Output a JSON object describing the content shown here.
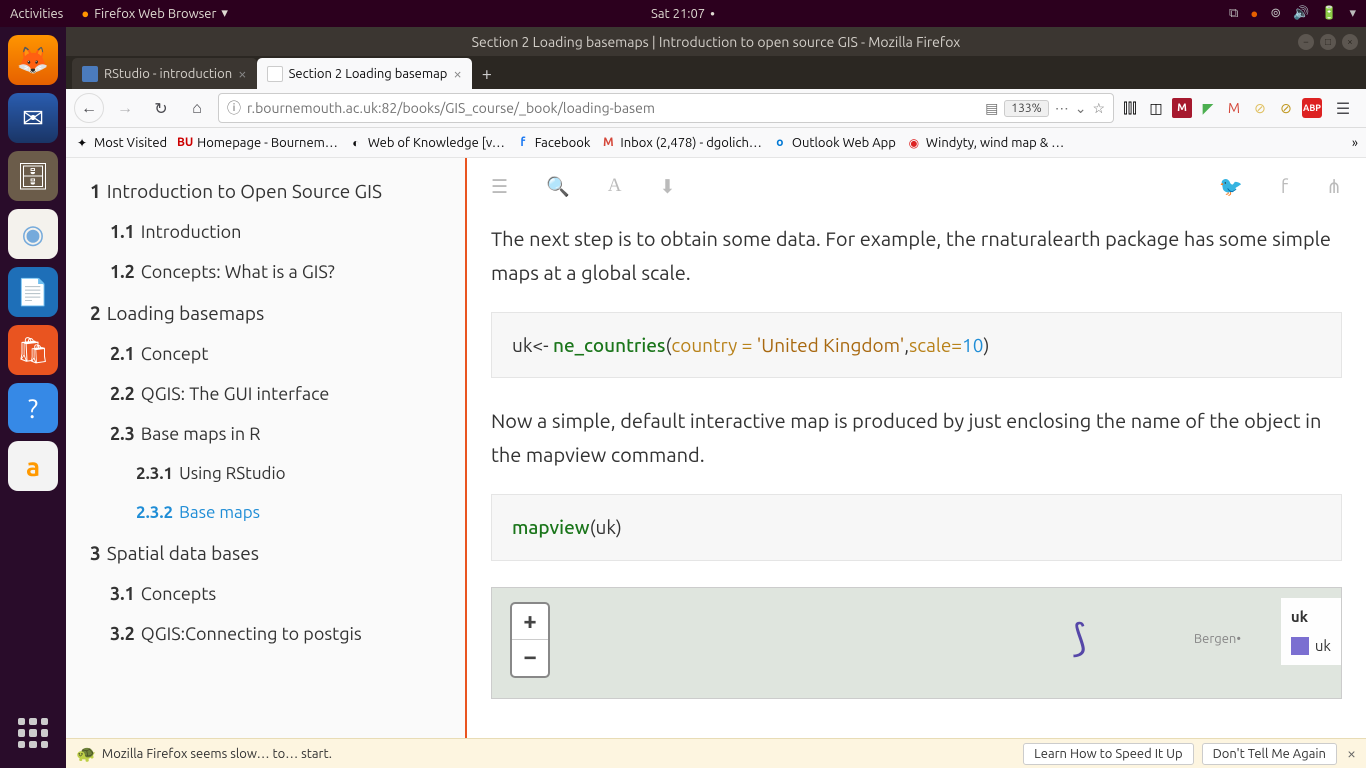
{
  "topbar": {
    "activities": "Activities",
    "app_label": "Firefox Web Browser",
    "clock": "Sat 21:07"
  },
  "window": {
    "title": "Section 2 Loading basemaps | Introduction to open source GIS - Mozilla Firefox"
  },
  "tabs": {
    "inactive": {
      "label": "RStudio - introduction"
    },
    "active": {
      "label": "Section 2 Loading basemap"
    }
  },
  "urlbar": {
    "text": "r.bournemouth.ac.uk:82/books/GIS_course/_book/loading-basem",
    "zoom": "133%"
  },
  "bookmarks": {
    "most_visited": "Most Visited",
    "bourne": "Homepage - Bournem…",
    "wok": "Web of Knowledge [v…",
    "fb": "Facebook",
    "inbox": "Inbox (2,478) - dgolich…",
    "owa": "Outlook Web App",
    "windy": "Windyty, wind map & …"
  },
  "toc": {
    "s1": {
      "num": "1",
      "label": "Introduction to Open Source GIS"
    },
    "s11": {
      "num": "1.1",
      "label": "Introduction"
    },
    "s12": {
      "num": "1.2",
      "label": "Concepts: What is a GIS?"
    },
    "s2": {
      "num": "2",
      "label": "Loading basemaps"
    },
    "s21": {
      "num": "2.1",
      "label": "Concept"
    },
    "s22": {
      "num": "2.2",
      "label": "QGIS: The GUI interface"
    },
    "s23": {
      "num": "2.3",
      "label": "Base maps in R"
    },
    "s231": {
      "num": "2.3.1",
      "label": "Using RStudio"
    },
    "s232": {
      "num": "2.3.2",
      "label": "Base maps"
    },
    "s3": {
      "num": "3",
      "label": "Spatial data bases"
    },
    "s31": {
      "num": "3.1",
      "label": "Concepts"
    },
    "s32": {
      "num": "3.2",
      "label": "QGIS:Connecting to postgis"
    }
  },
  "doc": {
    "p1": "The next step is to obtain some data. For example, the rnaturalearth package has some simple maps at a global scale.",
    "p2": "Now a simple, default interactive map is produced by just enclosing the name of the object in the mapview command.",
    "code1": {
      "a": "uk<- ",
      "func": "ne_countries",
      "b": "(",
      "arg": "country = ",
      "str": "'United Kingdom'",
      "c": ",",
      "arg2": "scale=",
      "num": "10",
      "d": ")"
    },
    "code2": {
      "func": "mapview",
      "a": "(uk)"
    }
  },
  "map": {
    "zoom_in": "+",
    "zoom_out": "−",
    "legend_title": "uk",
    "legend_item": "uk",
    "city": "Bergen"
  },
  "notif": {
    "text": "Mozilla Firefox seems slow… to… start.",
    "btn1": "Learn How to Speed It Up",
    "btn2": "Don't Tell Me Again"
  }
}
